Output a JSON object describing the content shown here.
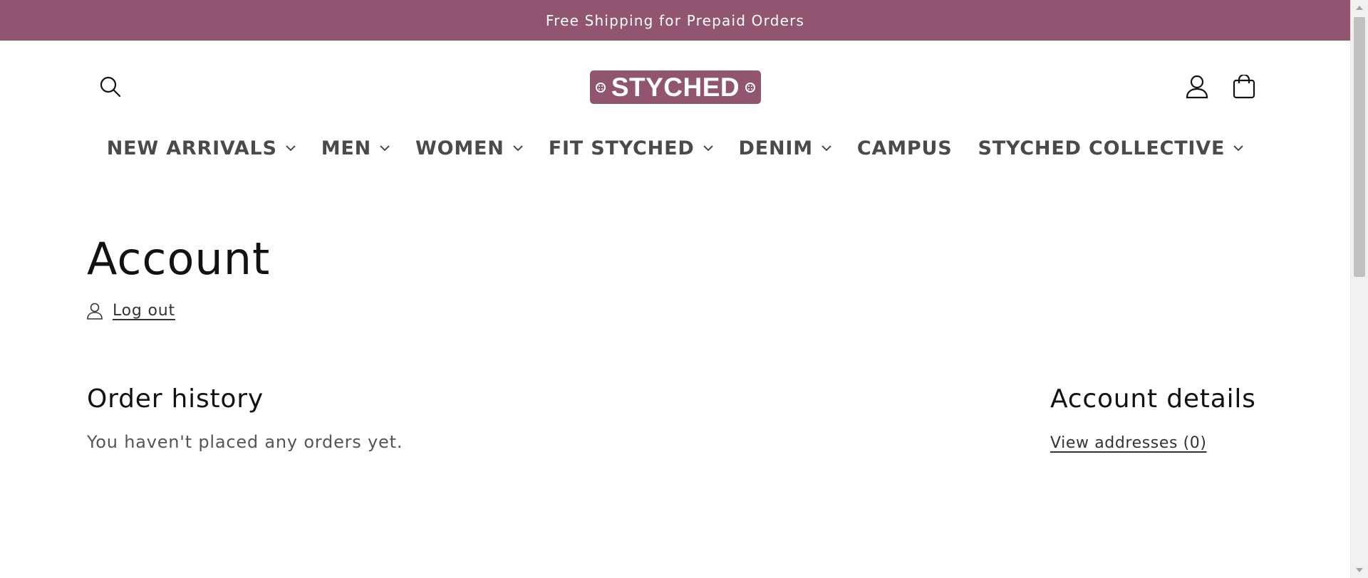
{
  "announcement": {
    "text": "Free Shipping for Prepaid Orders",
    "background_color": "#925570"
  },
  "header": {
    "logo_text": "STYCHED",
    "logo_color": "#925570",
    "icons": {
      "search": "search-icon",
      "account": "account-icon",
      "cart": "cart-icon"
    }
  },
  "nav": {
    "items": [
      {
        "label": "NEW ARRIVALS",
        "has_dropdown": true
      },
      {
        "label": "MEN",
        "has_dropdown": true
      },
      {
        "label": "WOMEN",
        "has_dropdown": true
      },
      {
        "label": "FIT STYCHED",
        "has_dropdown": true
      },
      {
        "label": "DENIM",
        "has_dropdown": true
      },
      {
        "label": "CAMPUS",
        "has_dropdown": false
      },
      {
        "label": "STYCHED COLLECTIVE",
        "has_dropdown": true
      }
    ]
  },
  "main": {
    "title": "Account",
    "logout_label": "Log out",
    "order_history": {
      "title": "Order history",
      "empty_message": "You haven't placed any orders yet."
    },
    "account_details": {
      "title": "Account details",
      "view_addresses_label": "View addresses (0)"
    }
  }
}
